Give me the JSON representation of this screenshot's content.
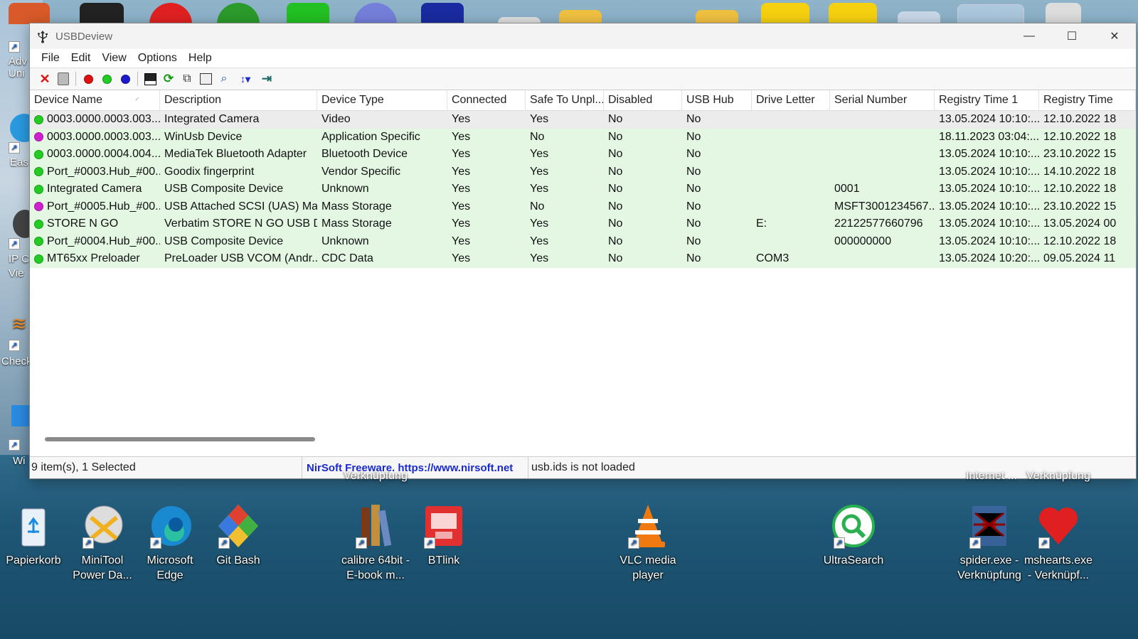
{
  "window": {
    "title": "USBDeview",
    "menu": [
      "File",
      "Edit",
      "View",
      "Options",
      "Help"
    ],
    "controls": {
      "minimize": "—",
      "maximize": "☐",
      "close": "✕"
    }
  },
  "toolbar": {
    "buttons": [
      "disconnect-icon",
      "uninstall-icon",
      "red-dot-icon",
      "green-dot-icon",
      "blue-dot-icon",
      "save-icon",
      "refresh-icon",
      "copy-icon",
      "properties-icon",
      "find-icon",
      "sort-icon",
      "exit-icon"
    ],
    "colors": {
      "red": "#e01010",
      "green": "#22cc22",
      "blue": "#1a1acc"
    }
  },
  "table": {
    "columns": [
      "Device Name",
      "Description",
      "Device Type",
      "Connected",
      "Safe To Unpl...",
      "Disabled",
      "USB Hub",
      "Drive Letter",
      "Serial Number",
      "Registry Time 1",
      "Registry Time"
    ],
    "sort_indicator": "⸍",
    "rows": [
      {
        "dot": "#22cc22",
        "cells": [
          "0003.0000.0003.003....",
          "Integrated Camera",
          "Video",
          "Yes",
          "Yes",
          "No",
          "No",
          "",
          "",
          "13.05.2024 10:10:...",
          "12.10.2022 18"
        ]
      },
      {
        "dot": "#d020d0",
        "cells": [
          "0003.0000.0003.003....",
          "WinUsb Device",
          "Application Specific",
          "Yes",
          "No",
          "No",
          "No",
          "",
          "",
          "18.11.2023 03:04:...",
          "12.10.2022 18"
        ]
      },
      {
        "dot": "#22cc22",
        "cells": [
          "0003.0000.0004.004....",
          "MediaTek Bluetooth Adapter",
          "Bluetooth Device",
          "Yes",
          "Yes",
          "No",
          "No",
          "",
          "",
          "13.05.2024 10:10:...",
          "23.10.2022 15"
        ]
      },
      {
        "dot": "#22cc22",
        "cells": [
          "Port_#0003.Hub_#00...",
          "Goodix fingerprint",
          "Vendor Specific",
          "Yes",
          "Yes",
          "No",
          "No",
          "",
          "",
          "13.05.2024 10:10:...",
          "14.10.2022 18"
        ]
      },
      {
        "dot": "#22cc22",
        "cells": [
          "Integrated Camera",
          "USB Composite Device",
          "Unknown",
          "Yes",
          "Yes",
          "No",
          "No",
          "",
          "0001",
          "13.05.2024 10:10:...",
          "12.10.2022 18"
        ]
      },
      {
        "dot": "#d020d0",
        "cells": [
          "Port_#0005.Hub_#00...",
          "USB Attached SCSI (UAS) Ma...",
          "Mass Storage",
          "Yes",
          "No",
          "No",
          "No",
          "",
          "MSFT3001234567...",
          "13.05.2024 10:10:...",
          "23.10.2022 15"
        ]
      },
      {
        "dot": "#22cc22",
        "cells": [
          "STORE N GO",
          "Verbatim STORE N GO USB D...",
          "Mass Storage",
          "Yes",
          "Yes",
          "No",
          "No",
          "E:",
          "22122577660796",
          "13.05.2024 10:10:...",
          "13.05.2024 00"
        ]
      },
      {
        "dot": "#22cc22",
        "cells": [
          "Port_#0004.Hub_#00...",
          "USB Composite Device",
          "Unknown",
          "Yes",
          "Yes",
          "No",
          "No",
          "",
          "000000000",
          "13.05.2024 10:10:...",
          "12.10.2022 18"
        ]
      },
      {
        "dot": "#22cc22",
        "cells": [
          "MT65xx Preloader",
          "PreLoader USB VCOM (Andr...",
          "CDC Data",
          "Yes",
          "Yes",
          "No",
          "No",
          "COM3",
          "",
          "13.05.2024 10:20:...",
          "09.05.2024 11"
        ]
      }
    ]
  },
  "statusbar": {
    "count": "9 item(s), 1 Selected",
    "link": "NirSoft Freeware.  https://www.nirsoft.net",
    "ids": "usb.ids is not loaded"
  },
  "desktop": {
    "left_fragments": [
      "Adv\nUni",
      "Eas",
      "IP C\nVie",
      "Check",
      "Wi"
    ],
    "above_labels": {
      "verkn1": "Verknüpfung",
      "internet": "Internet ...",
      "verkn2": "Verknüpfung"
    },
    "icons": [
      {
        "label": "Papierkorb",
        "icon": "recycle-bin-icon"
      },
      {
        "label": "MiniTool Power Da...",
        "icon": "minitool-icon"
      },
      {
        "label": "Microsoft Edge",
        "icon": "edge-icon"
      },
      {
        "label": "Git Bash",
        "icon": "git-icon"
      },
      {
        "label": "calibre 64bit - E-book m...",
        "icon": "calibre-icon"
      },
      {
        "label": "BTlink",
        "icon": "btlink-icon"
      },
      {
        "label": "VLC media player",
        "icon": "vlc-icon"
      },
      {
        "label": "UltraSearch",
        "icon": "ultrasearch-icon"
      },
      {
        "label": "spider.exe - Verknüpfung",
        "icon": "spider-icon"
      },
      {
        "label": "mshearts.exe - Verknüpf...",
        "icon": "hearts-icon"
      }
    ]
  }
}
